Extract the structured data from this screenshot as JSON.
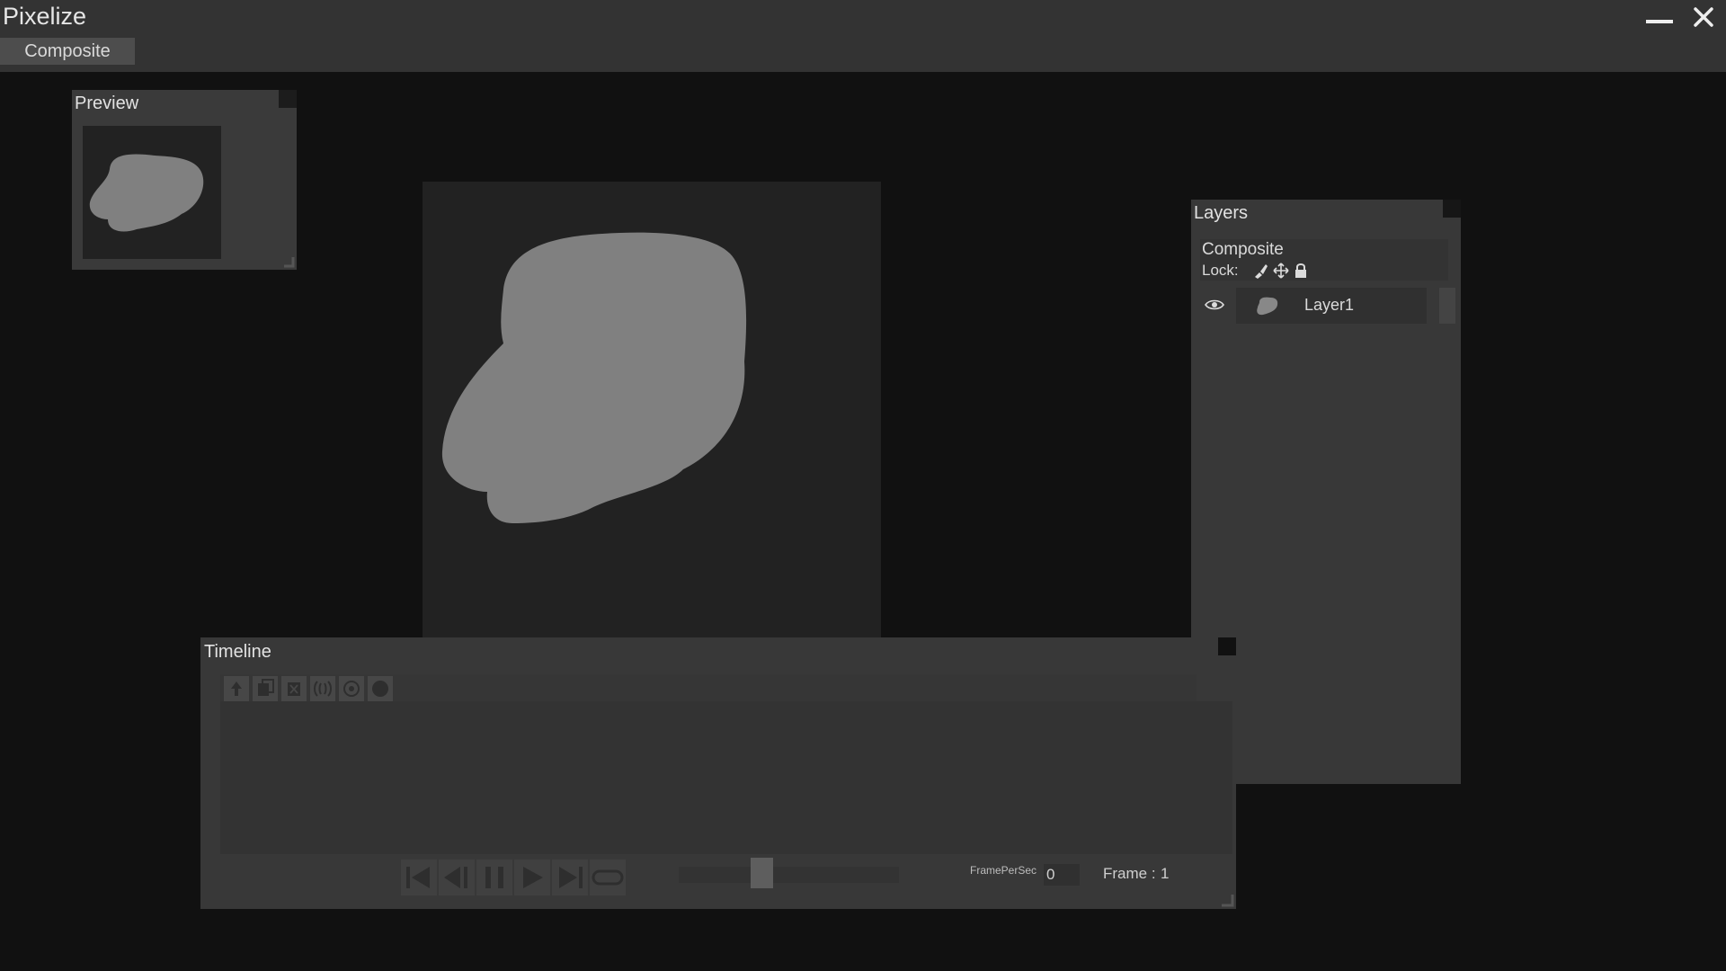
{
  "app": {
    "title": "Pixelize"
  },
  "tabs": [
    {
      "label": "Composite",
      "active": true
    }
  ],
  "panels": {
    "preview": {
      "title": "Preview"
    },
    "layers": {
      "title": "Layers",
      "group_name": "Composite",
      "lock_label": "Lock:",
      "lock_icons": [
        "brush-lock-icon",
        "move-lock-icon",
        "padlock-icon"
      ],
      "items": [
        {
          "name": "Layer1",
          "visible": true
        }
      ]
    },
    "timeline": {
      "title": "Timeline",
      "tools": [
        "add-frame-icon",
        "copy-frame-icon",
        "delete-frame-icon",
        "onion-skin-icon",
        "onion-settings-icon",
        "record-icon"
      ],
      "playback": [
        "first-frame-icon",
        "prev-frame-icon",
        "pause-icon",
        "play-icon",
        "last-frame-icon",
        "loop-icon"
      ],
      "fps_label": "FramePerSec",
      "fps_value": "0",
      "frame_label": "Frame :",
      "frame_value": "1"
    }
  },
  "colors": {
    "background": "#111111",
    "panel": "#383838",
    "titlebar": "#333333",
    "tab_active": "#4d4d4d",
    "shape": "#808080"
  }
}
